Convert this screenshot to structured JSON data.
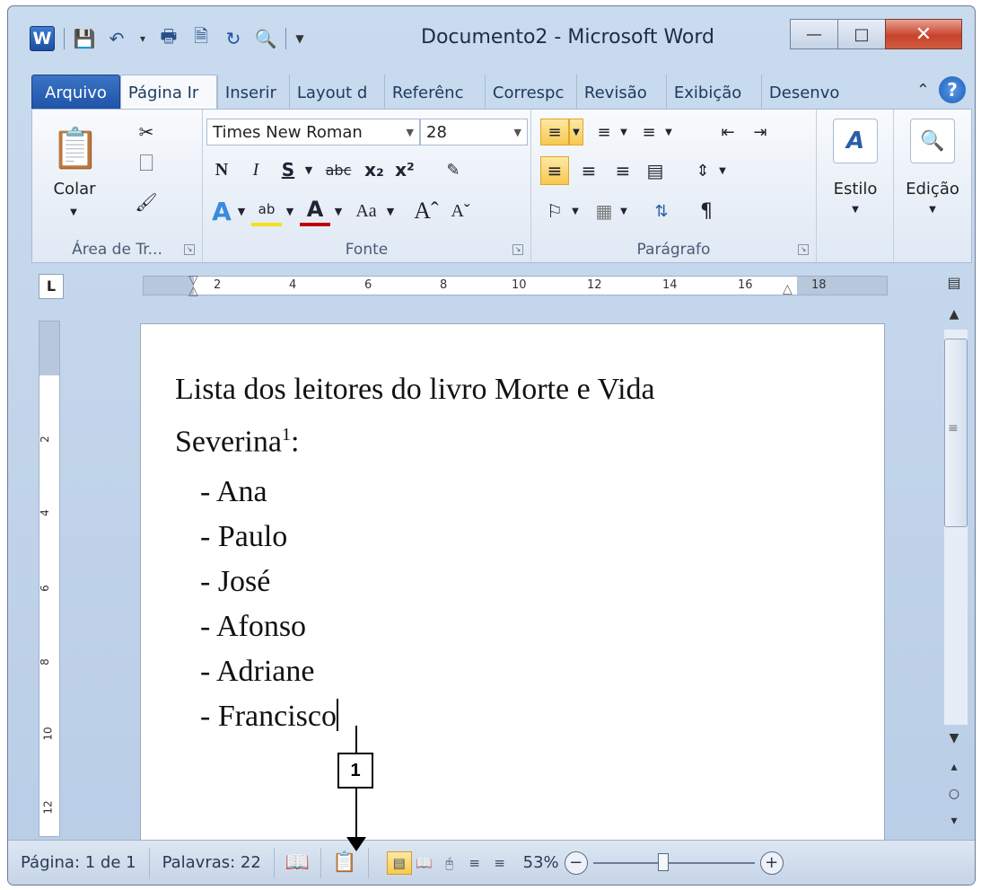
{
  "window": {
    "title": "Documento2 - Microsoft Word",
    "app_icon_letter": "W"
  },
  "tabs": [
    {
      "label": "Arquivo"
    },
    {
      "label": "Página Ir"
    },
    {
      "label": "Inserir"
    },
    {
      "label": "Layout d"
    },
    {
      "label": "Referênc"
    },
    {
      "label": "Correspc"
    },
    {
      "label": "Revisão"
    },
    {
      "label": "Exibição"
    },
    {
      "label": "Desenvo"
    }
  ],
  "ribbon": {
    "clipboard": {
      "label": "Área de Tr...",
      "paste_label": "Colar"
    },
    "font": {
      "label": "Fonte",
      "font_name": "Times New Roman",
      "font_size": "28"
    },
    "paragraph": {
      "label": "Parágrafo"
    },
    "styles": {
      "label": "Estilo"
    },
    "editing": {
      "label": "Edição"
    }
  },
  "ruler": {
    "corner": "L",
    "ticks": [
      "2",
      "4",
      "6",
      "8",
      "10",
      "12",
      "14",
      "16",
      "18"
    ],
    "vticks": [
      "2",
      "4",
      "6",
      "8",
      "10",
      "12"
    ]
  },
  "document": {
    "heading_line1": "Lista dos leitores do livro Morte e Vida",
    "heading_line2": "Severina",
    "footnote_ref": "1",
    "heading_suffix": ":",
    "items": [
      "- Ana",
      "- Paulo",
      "- José",
      "- Afonso",
      "- Adriane",
      "- Francisco"
    ]
  },
  "statusbar": {
    "page": "Página: 1 de 1",
    "words": "Palavras: 22",
    "zoom": "53%"
  },
  "annotation": {
    "label": "1"
  },
  "colors": {
    "accent": "#1f53a8",
    "selected": "#f7c84f",
    "close": "#c7432c"
  }
}
